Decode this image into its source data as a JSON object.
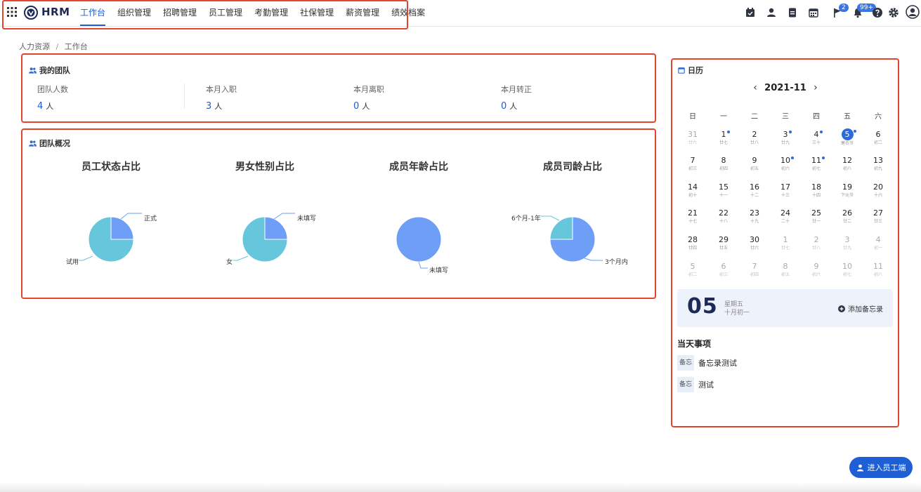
{
  "app": {
    "brand": "HRM"
  },
  "nav": {
    "items": [
      "工作台",
      "组织管理",
      "招聘管理",
      "员工管理",
      "考勤管理",
      "社保管理",
      "薪资管理",
      "绩效档案"
    ],
    "active_index": 0
  },
  "toolbar": {
    "icons": [
      "calendar-check-icon",
      "user-icon",
      "document-icon",
      "calendar-icon",
      "flag-icon",
      "bell-icon",
      "help-icon",
      "gear-icon",
      "avatar-icon"
    ],
    "flag_badge": "2",
    "bell_badge": "99+"
  },
  "breadcrumb": {
    "root": "人力资源",
    "separator": "/",
    "current": "工作台"
  },
  "team": {
    "title": "我的团队",
    "stats": [
      {
        "label": "团队人数",
        "value": "4",
        "unit": "人"
      },
      {
        "label": "本月入职",
        "value": "3",
        "unit": "人"
      },
      {
        "label": "本月离职",
        "value": "0",
        "unit": "人"
      },
      {
        "label": "本月转正",
        "value": "0",
        "unit": "人"
      }
    ]
  },
  "overview": {
    "title": "团队概况"
  },
  "chart_data": [
    {
      "type": "pie",
      "title": "员工状态占比",
      "slices": [
        {
          "label": "正式",
          "value": 1,
          "color": "#6e9ef6"
        },
        {
          "label": "试用",
          "value": 3,
          "color": "#65c6dc"
        }
      ]
    },
    {
      "type": "pie",
      "title": "男女性别占比",
      "slices": [
        {
          "label": "未填写",
          "value": 1,
          "color": "#6e9ef6"
        },
        {
          "label": "女",
          "value": 3,
          "color": "#65c6dc"
        }
      ]
    },
    {
      "type": "pie",
      "title": "成员年龄占比",
      "slices": [
        {
          "label": "未填写",
          "value": 4,
          "color": "#6e9ef6"
        }
      ]
    },
    {
      "type": "pie",
      "title": "成员司龄占比",
      "slices": [
        {
          "label": "3个月内",
          "value": 3,
          "color": "#6e9ef6"
        },
        {
          "label": "6个月-1年",
          "value": 1,
          "color": "#65c6dc"
        }
      ]
    }
  ],
  "calendar": {
    "title": "日历",
    "month": "2021-11",
    "weekdays": [
      "日",
      "一",
      "二",
      "三",
      "四",
      "五",
      "六"
    ],
    "days": [
      {
        "d": "31",
        "l": "廿六",
        "dim": true
      },
      {
        "d": "1",
        "l": "廿七",
        "dot": true
      },
      {
        "d": "2",
        "l": "廿八"
      },
      {
        "d": "3",
        "l": "廿九",
        "dot": true
      },
      {
        "d": "4",
        "l": "三十",
        "dot": true
      },
      {
        "d": "5",
        "l": "寒衣节",
        "today": true,
        "dot": true
      },
      {
        "d": "6",
        "l": "初二"
      },
      {
        "d": "7",
        "l": "初三"
      },
      {
        "d": "8",
        "l": "初四"
      },
      {
        "d": "9",
        "l": "初五"
      },
      {
        "d": "10",
        "l": "初六",
        "dot": true
      },
      {
        "d": "11",
        "l": "初七",
        "dot": true
      },
      {
        "d": "12",
        "l": "初八"
      },
      {
        "d": "13",
        "l": "初九"
      },
      {
        "d": "14",
        "l": "初十"
      },
      {
        "d": "15",
        "l": "十一"
      },
      {
        "d": "16",
        "l": "十二"
      },
      {
        "d": "17",
        "l": "十三"
      },
      {
        "d": "18",
        "l": "十四"
      },
      {
        "d": "19",
        "l": "下元节"
      },
      {
        "d": "20",
        "l": "十六"
      },
      {
        "d": "21",
        "l": "十七"
      },
      {
        "d": "22",
        "l": "十八"
      },
      {
        "d": "23",
        "l": "十九"
      },
      {
        "d": "24",
        "l": "二十"
      },
      {
        "d": "25",
        "l": "廿一"
      },
      {
        "d": "26",
        "l": "廿二"
      },
      {
        "d": "27",
        "l": "廿三"
      },
      {
        "d": "28",
        "l": "廿四"
      },
      {
        "d": "29",
        "l": "廿五"
      },
      {
        "d": "30",
        "l": "廿六"
      },
      {
        "d": "1",
        "l": "廿七",
        "dim": true
      },
      {
        "d": "2",
        "l": "廿八",
        "dim": true
      },
      {
        "d": "3",
        "l": "廿九",
        "dim": true
      },
      {
        "d": "4",
        "l": "初一",
        "dim": true
      },
      {
        "d": "5",
        "l": "初二",
        "dim": true
      },
      {
        "d": "6",
        "l": "初三",
        "dim": true
      },
      {
        "d": "7",
        "l": "初四",
        "dim": true
      },
      {
        "d": "8",
        "l": "初五",
        "dim": true
      },
      {
        "d": "9",
        "l": "初六",
        "dim": true
      },
      {
        "d": "10",
        "l": "初七",
        "dim": true
      },
      {
        "d": "11",
        "l": "初八",
        "dim": true
      }
    ],
    "selected_day": "05",
    "selected_weekday": "星期五",
    "selected_lunar": "十月初一",
    "add_memo": "添加备忘录",
    "events_title": "当天事项",
    "events": [
      {
        "tag": "备忘",
        "text": "备忘录测试"
      },
      {
        "tag": "备忘",
        "text": "测试"
      }
    ]
  },
  "float_button": "进入员工端"
}
